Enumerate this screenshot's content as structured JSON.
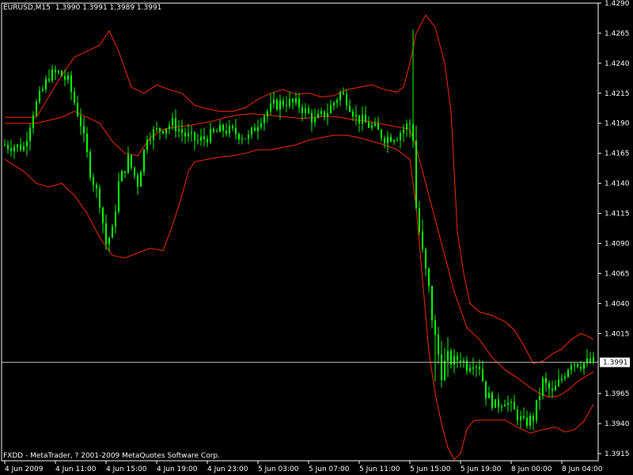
{
  "header": {
    "symbol": "EURUSD,M15",
    "ohlc": "1.3990 1.3991 1.3989 1.3991"
  },
  "footer": {
    "copyright": "FXDD - MetaTrader, ? 2001-2009 MetaQuotes Software Corp."
  },
  "current_price": {
    "label": "1.3991",
    "value": 1.3991
  },
  "colors": {
    "background": "#000000",
    "candle": "#00ff00",
    "bands": "#ff2a00",
    "axis": "#ffffff",
    "price_line": "#c0c0c0",
    "price_box": "#ffffff"
  },
  "chart_data": {
    "type": "line",
    "ylim": [
      1.3905,
      1.429
    ],
    "y_ticks": [
      {
        "value": 1.429,
        "label": "1.4290"
      },
      {
        "value": 1.4265,
        "label": "1.4265"
      },
      {
        "value": 1.424,
        "label": "1.4240"
      },
      {
        "value": 1.4215,
        "label": "1.4215"
      },
      {
        "value": 1.419,
        "label": "1.4190"
      },
      {
        "value": 1.4165,
        "label": "1.4165"
      },
      {
        "value": 1.414,
        "label": "1.4140"
      },
      {
        "value": 1.4115,
        "label": "1.4115"
      },
      {
        "value": 1.409,
        "label": "1.4090"
      },
      {
        "value": 1.4065,
        "label": "1.4065"
      },
      {
        "value": 1.404,
        "label": "1.4040"
      },
      {
        "value": 1.4015,
        "label": "1.4015"
      },
      {
        "value": 1.3965,
        "label": "1.3965"
      },
      {
        "value": 1.394,
        "label": "1.3940"
      },
      {
        "value": 1.3915,
        "label": "1.3915"
      }
    ],
    "x_ticks": [
      {
        "bar": 0,
        "label": "4 Jun 2009"
      },
      {
        "bar": 16,
        "label": "4 Jun 11:00"
      },
      {
        "bar": 32,
        "label": "4 Jun 15:00"
      },
      {
        "bar": 48,
        "label": "4 Jun 19:00"
      },
      {
        "bar": 64,
        "label": "4 Jun 23:00"
      },
      {
        "bar": 80,
        "label": "5 Jun 03:00"
      },
      {
        "bar": 96,
        "label": "5 Jun 07:00"
      },
      {
        "bar": 112,
        "label": "5 Jun 11:00"
      },
      {
        "bar": 128,
        "label": "5 Jun 15:00"
      },
      {
        "bar": 144,
        "label": "5 Jun 19:00"
      },
      {
        "bar": 160,
        "label": "8 Jun 00:00"
      },
      {
        "bar": 176,
        "label": "8 Jun 04:00"
      }
    ],
    "bar_count": 187,
    "price_path": [
      [
        0,
        1.4172
      ],
      [
        6,
        1.417
      ],
      [
        9,
        1.42
      ],
      [
        14,
        1.423
      ],
      [
        17,
        1.4232
      ],
      [
        20,
        1.4225
      ],
      [
        24,
        1.419
      ],
      [
        27,
        1.415
      ],
      [
        30,
        1.4125
      ],
      [
        32,
        1.409
      ],
      [
        34,
        1.41
      ],
      [
        36,
        1.414
      ],
      [
        39,
        1.416
      ],
      [
        42,
        1.414
      ],
      [
        45,
        1.418
      ],
      [
        49,
        1.4185
      ],
      [
        53,
        1.419
      ],
      [
        57,
        1.418
      ],
      [
        61,
        1.4175
      ],
      [
        65,
        1.418
      ],
      [
        69,
        1.4185
      ],
      [
        73,
        1.4182
      ],
      [
        77,
        1.4178
      ],
      [
        81,
        1.4195
      ],
      [
        85,
        1.4205
      ],
      [
        89,
        1.4208
      ],
      [
        93,
        1.4205
      ],
      [
        98,
        1.4192
      ],
      [
        102,
        1.42
      ],
      [
        106,
        1.4215
      ],
      [
        108,
        1.421
      ],
      [
        111,
        1.4195
      ],
      [
        114,
        1.419
      ],
      [
        117,
        1.4185
      ],
      [
        120,
        1.4178
      ],
      [
        124,
        1.418
      ],
      [
        127,
        1.4188
      ],
      [
        128,
        1.419
      ],
      [
        129,
        1.418
      ],
      [
        130,
        1.412
      ],
      [
        132,
        1.408
      ],
      [
        134,
        1.405
      ],
      [
        136,
        1.401
      ],
      [
        138,
        1.3985
      ],
      [
        140,
        1.3992
      ],
      [
        142,
        1.3992
      ],
      [
        144,
        1.3995
      ],
      [
        146,
        1.3988
      ],
      [
        148,
        1.3992
      ],
      [
        150,
        1.3988
      ],
      [
        152,
        1.3965
      ],
      [
        155,
        1.3955
      ],
      [
        158,
        1.396
      ],
      [
        161,
        1.395
      ],
      [
        164,
        1.394
      ],
      [
        167,
        1.3945
      ],
      [
        170,
        1.3975
      ],
      [
        173,
        1.3965
      ],
      [
        176,
        1.3978
      ],
      [
        179,
        1.3992
      ],
      [
        182,
        1.399
      ],
      [
        186,
        1.3991
      ]
    ],
    "series": [
      {
        "values": [
          [
            0,
            1.4195
          ],
          [
            10,
            1.4195
          ],
          [
            18,
            1.423
          ],
          [
            22,
            1.4245
          ],
          [
            26,
            1.425
          ],
          [
            30,
            1.4255
          ],
          [
            33,
            1.4267
          ],
          [
            36,
            1.425
          ],
          [
            40,
            1.422
          ],
          [
            44,
            1.4215
          ],
          [
            48,
            1.4222
          ],
          [
            52,
            1.4218
          ],
          [
            56,
            1.4215
          ],
          [
            60,
            1.4205
          ],
          [
            64,
            1.4202
          ],
          [
            68,
            1.42
          ],
          [
            72,
            1.42
          ],
          [
            76,
            1.4203
          ],
          [
            80,
            1.421
          ],
          [
            84,
            1.4215
          ],
          [
            88,
            1.4218
          ],
          [
            92,
            1.4214
          ],
          [
            96,
            1.4215
          ],
          [
            100,
            1.4212
          ],
          [
            104,
            1.4213
          ],
          [
            108,
            1.4218
          ],
          [
            112,
            1.422
          ],
          [
            116,
            1.4222
          ],
          [
            120,
            1.4218
          ],
          [
            124,
            1.4216
          ],
          [
            126,
            1.422
          ],
          [
            128,
            1.424
          ],
          [
            130,
            1.4265
          ],
          [
            133,
            1.428
          ],
          [
            136,
            1.427
          ],
          [
            139,
            1.424
          ],
          [
            141,
            1.42
          ],
          [
            143,
            1.41
          ],
          [
            145,
            1.4065
          ],
          [
            147,
            1.404
          ],
          [
            150,
            1.4033
          ],
          [
            154,
            1.403
          ],
          [
            158,
            1.4025
          ],
          [
            161,
            1.4018
          ],
          [
            164,
            1.4005
          ],
          [
            167,
            1.399
          ],
          [
            170,
            1.3992
          ],
          [
            173,
            1.3998
          ],
          [
            176,
            1.4002
          ],
          [
            179,
            1.401
          ],
          [
            182,
            1.4015
          ],
          [
            184,
            1.4013
          ],
          [
            186,
            1.401
          ]
        ]
      },
      {
        "values": [
          [
            0,
            1.419
          ],
          [
            10,
            1.419
          ],
          [
            18,
            1.4195
          ],
          [
            22,
            1.42
          ],
          [
            26,
            1.4195
          ],
          [
            30,
            1.419
          ],
          [
            34,
            1.4175
          ],
          [
            38,
            1.4165
          ],
          [
            42,
            1.4163
          ],
          [
            46,
            1.4178
          ],
          [
            50,
            1.4185
          ],
          [
            54,
            1.4187
          ],
          [
            58,
            1.4188
          ],
          [
            62,
            1.419
          ],
          [
            66,
            1.4192
          ],
          [
            70,
            1.4195
          ],
          [
            74,
            1.4197
          ],
          [
            78,
            1.4198
          ],
          [
            82,
            1.4197
          ],
          [
            86,
            1.4196
          ],
          [
            90,
            1.4195
          ],
          [
            94,
            1.4194
          ],
          [
            98,
            1.4195
          ],
          [
            102,
            1.4196
          ],
          [
            106,
            1.4195
          ],
          [
            110,
            1.4193
          ],
          [
            114,
            1.4192
          ],
          [
            118,
            1.419
          ],
          [
            122,
            1.4188
          ],
          [
            126,
            1.4186
          ],
          [
            128,
            1.4185
          ],
          [
            130,
            1.417
          ],
          [
            133,
            1.414
          ],
          [
            136,
            1.411
          ],
          [
            139,
            1.408
          ],
          [
            142,
            1.405
          ],
          [
            146,
            1.402
          ],
          [
            150,
            1.401
          ],
          [
            154,
            1.3995
          ],
          [
            158,
            1.3985
          ],
          [
            162,
            1.3978
          ],
          [
            166,
            1.397
          ],
          [
            169,
            1.3965
          ],
          [
            172,
            1.3962
          ],
          [
            175,
            1.3963
          ],
          [
            178,
            1.3968
          ],
          [
            181,
            1.3975
          ],
          [
            184,
            1.398
          ],
          [
            186,
            1.3983
          ]
        ]
      },
      {
        "values": [
          [
            0,
            1.416
          ],
          [
            6,
            1.415
          ],
          [
            10,
            1.414
          ],
          [
            14,
            1.4137
          ],
          [
            18,
            1.414
          ],
          [
            22,
            1.413
          ],
          [
            26,
            1.4115
          ],
          [
            30,
            1.4095
          ],
          [
            34,
            1.408
          ],
          [
            38,
            1.4078
          ],
          [
            42,
            1.4082
          ],
          [
            46,
            1.4086
          ],
          [
            50,
            1.4084
          ],
          [
            53,
            1.4105
          ],
          [
            56,
            1.413
          ],
          [
            58,
            1.415
          ],
          [
            60,
            1.4158
          ],
          [
            64,
            1.416
          ],
          [
            68,
            1.4162
          ],
          [
            72,
            1.4163
          ],
          [
            76,
            1.4165
          ],
          [
            80,
            1.4168
          ],
          [
            84,
            1.4168
          ],
          [
            88,
            1.417
          ],
          [
            92,
            1.4172
          ],
          [
            96,
            1.4176
          ],
          [
            100,
            1.4178
          ],
          [
            104,
            1.418
          ],
          [
            108,
            1.418
          ],
          [
            112,
            1.4178
          ],
          [
            116,
            1.4175
          ],
          [
            120,
            1.4172
          ],
          [
            124,
            1.4168
          ],
          [
            128,
            1.416
          ],
          [
            130,
            1.412
          ],
          [
            132,
            1.406
          ],
          [
            134,
            1.4
          ],
          [
            136,
            1.3965
          ],
          [
            138,
            1.394
          ],
          [
            140,
            1.392
          ],
          [
            142,
            1.391
          ],
          [
            144,
            1.3915
          ],
          [
            146,
            1.3935
          ],
          [
            148,
            1.3942
          ],
          [
            150,
            1.3943
          ],
          [
            154,
            1.3943
          ],
          [
            158,
            1.3943
          ],
          [
            162,
            1.3937
          ],
          [
            166,
            1.3932
          ],
          [
            170,
            1.3935
          ],
          [
            174,
            1.3937
          ],
          [
            177,
            1.3933
          ],
          [
            180,
            1.3935
          ],
          [
            183,
            1.3942
          ],
          [
            186,
            1.3956
          ]
        ]
      }
    ]
  }
}
